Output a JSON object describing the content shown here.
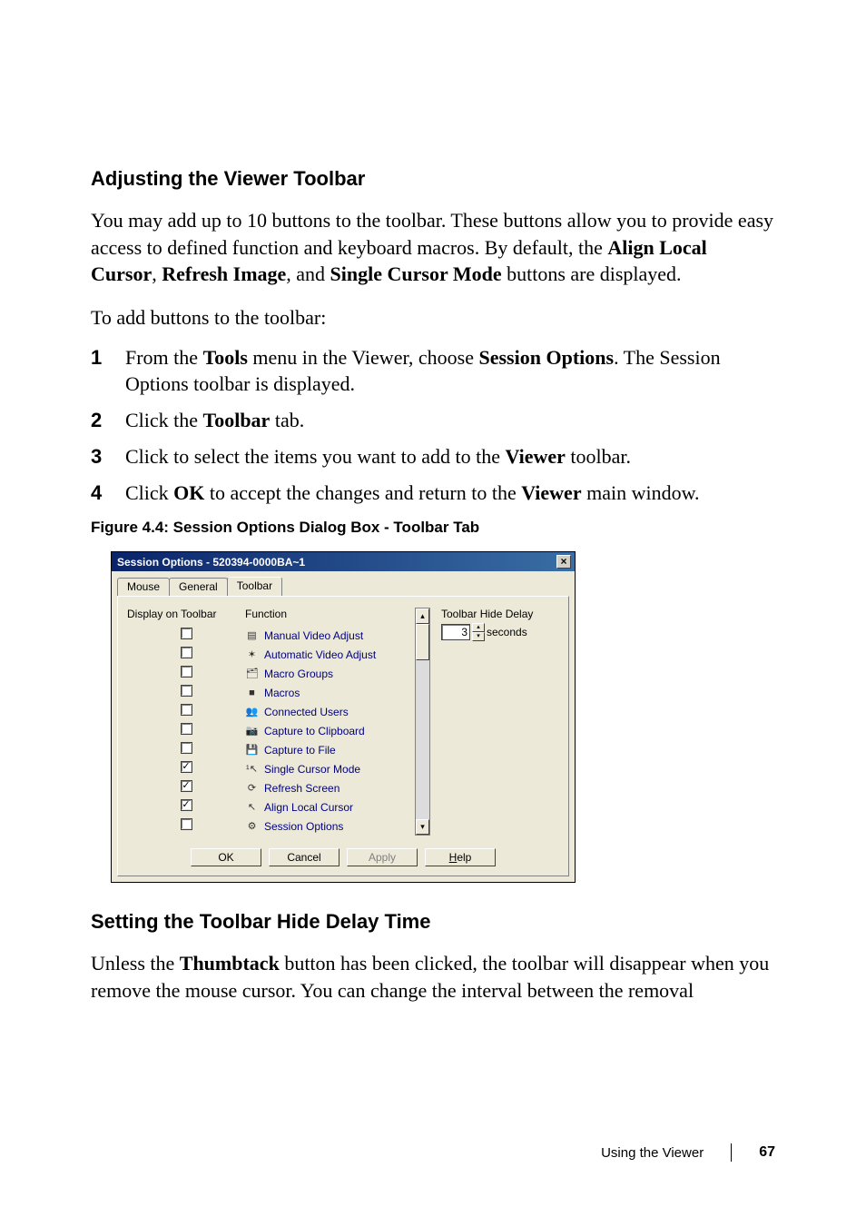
{
  "section1": {
    "heading": "Adjusting the Viewer Toolbar",
    "para": "You may add up to 10 buttons to the toolbar. These buttons allow you to provide easy access to defined function and keyboard macros. By default, the ",
    "bold1": "Align Local Cursor",
    "comma1": ", ",
    "bold2": "Refresh Image",
    "comma2": ", and ",
    "bold3": "Single Cursor Mode",
    "para_tail": " buttons are displayed.",
    "lead": "To add buttons to the toolbar:"
  },
  "steps": [
    {
      "n": "1",
      "pre": "From the ",
      "b1": "Tools",
      "mid": " menu in the Viewer, choose ",
      "b2": "Session Options",
      "post": ". The Session Options toolbar is displayed."
    },
    {
      "n": "2",
      "pre": "Click the ",
      "b1": "Toolbar",
      "post": " tab."
    },
    {
      "n": "3",
      "pre": "Click to select the items you want to add to the ",
      "b1": "Viewer",
      "post": " toolbar."
    },
    {
      "n": "4",
      "pre": "Click ",
      "b1": "OK",
      "mid": " to accept the changes and return to the ",
      "b2": "Viewer",
      "post": " main window."
    }
  ],
  "figure_caption": "Figure 4.4: Session Options Dialog Box - Toolbar Tab",
  "dialog": {
    "title": "Session Options - 520394-0000BA~1",
    "close_glyph": "×",
    "tabs": {
      "mouse": "Mouse",
      "general": "General",
      "toolbar": "Toolbar"
    },
    "columns": {
      "display": "Display on Toolbar",
      "function": "Function"
    },
    "delay_label": "Toolbar Hide Delay",
    "delay_value": "3",
    "delay_unit": "seconds",
    "functions": [
      {
        "icon": "sliders-icon",
        "label": "Manual Video Adjust",
        "checked": false
      },
      {
        "icon": "wand-icon",
        "label": "Automatic Video Adjust",
        "checked": false
      },
      {
        "icon": "folders-icon",
        "label": "Macro Groups",
        "checked": false
      },
      {
        "icon": "square-icon",
        "label": "Macros",
        "checked": false
      },
      {
        "icon": "users-icon",
        "label": "Connected Users",
        "checked": false
      },
      {
        "icon": "camera-icon",
        "label": "Capture to Clipboard",
        "checked": false
      },
      {
        "icon": "disk-icon",
        "label": "Capture to File",
        "checked": false
      },
      {
        "icon": "cursor1-icon",
        "label": "Single Cursor Mode",
        "checked": true
      },
      {
        "icon": "refresh-icon",
        "label": "Refresh Screen",
        "checked": true
      },
      {
        "icon": "cursor-icon",
        "label": "Align Local Cursor",
        "checked": true
      },
      {
        "icon": "options-icon",
        "label": "Session Options",
        "checked": false
      }
    ],
    "buttons": {
      "ok": "OK",
      "cancel": "Cancel",
      "apply": "Apply",
      "help": "Help",
      "help_key": "H"
    }
  },
  "section2": {
    "heading": "Setting the Toolbar Hide Delay Time",
    "para_pre": "Unless the ",
    "bold": "Thumbtack",
    "para_post": " button has been clicked, the toolbar will disappear when you remove the mouse cursor. You can change the interval between the removal"
  },
  "footer": {
    "section": "Using the Viewer",
    "page": "67"
  }
}
